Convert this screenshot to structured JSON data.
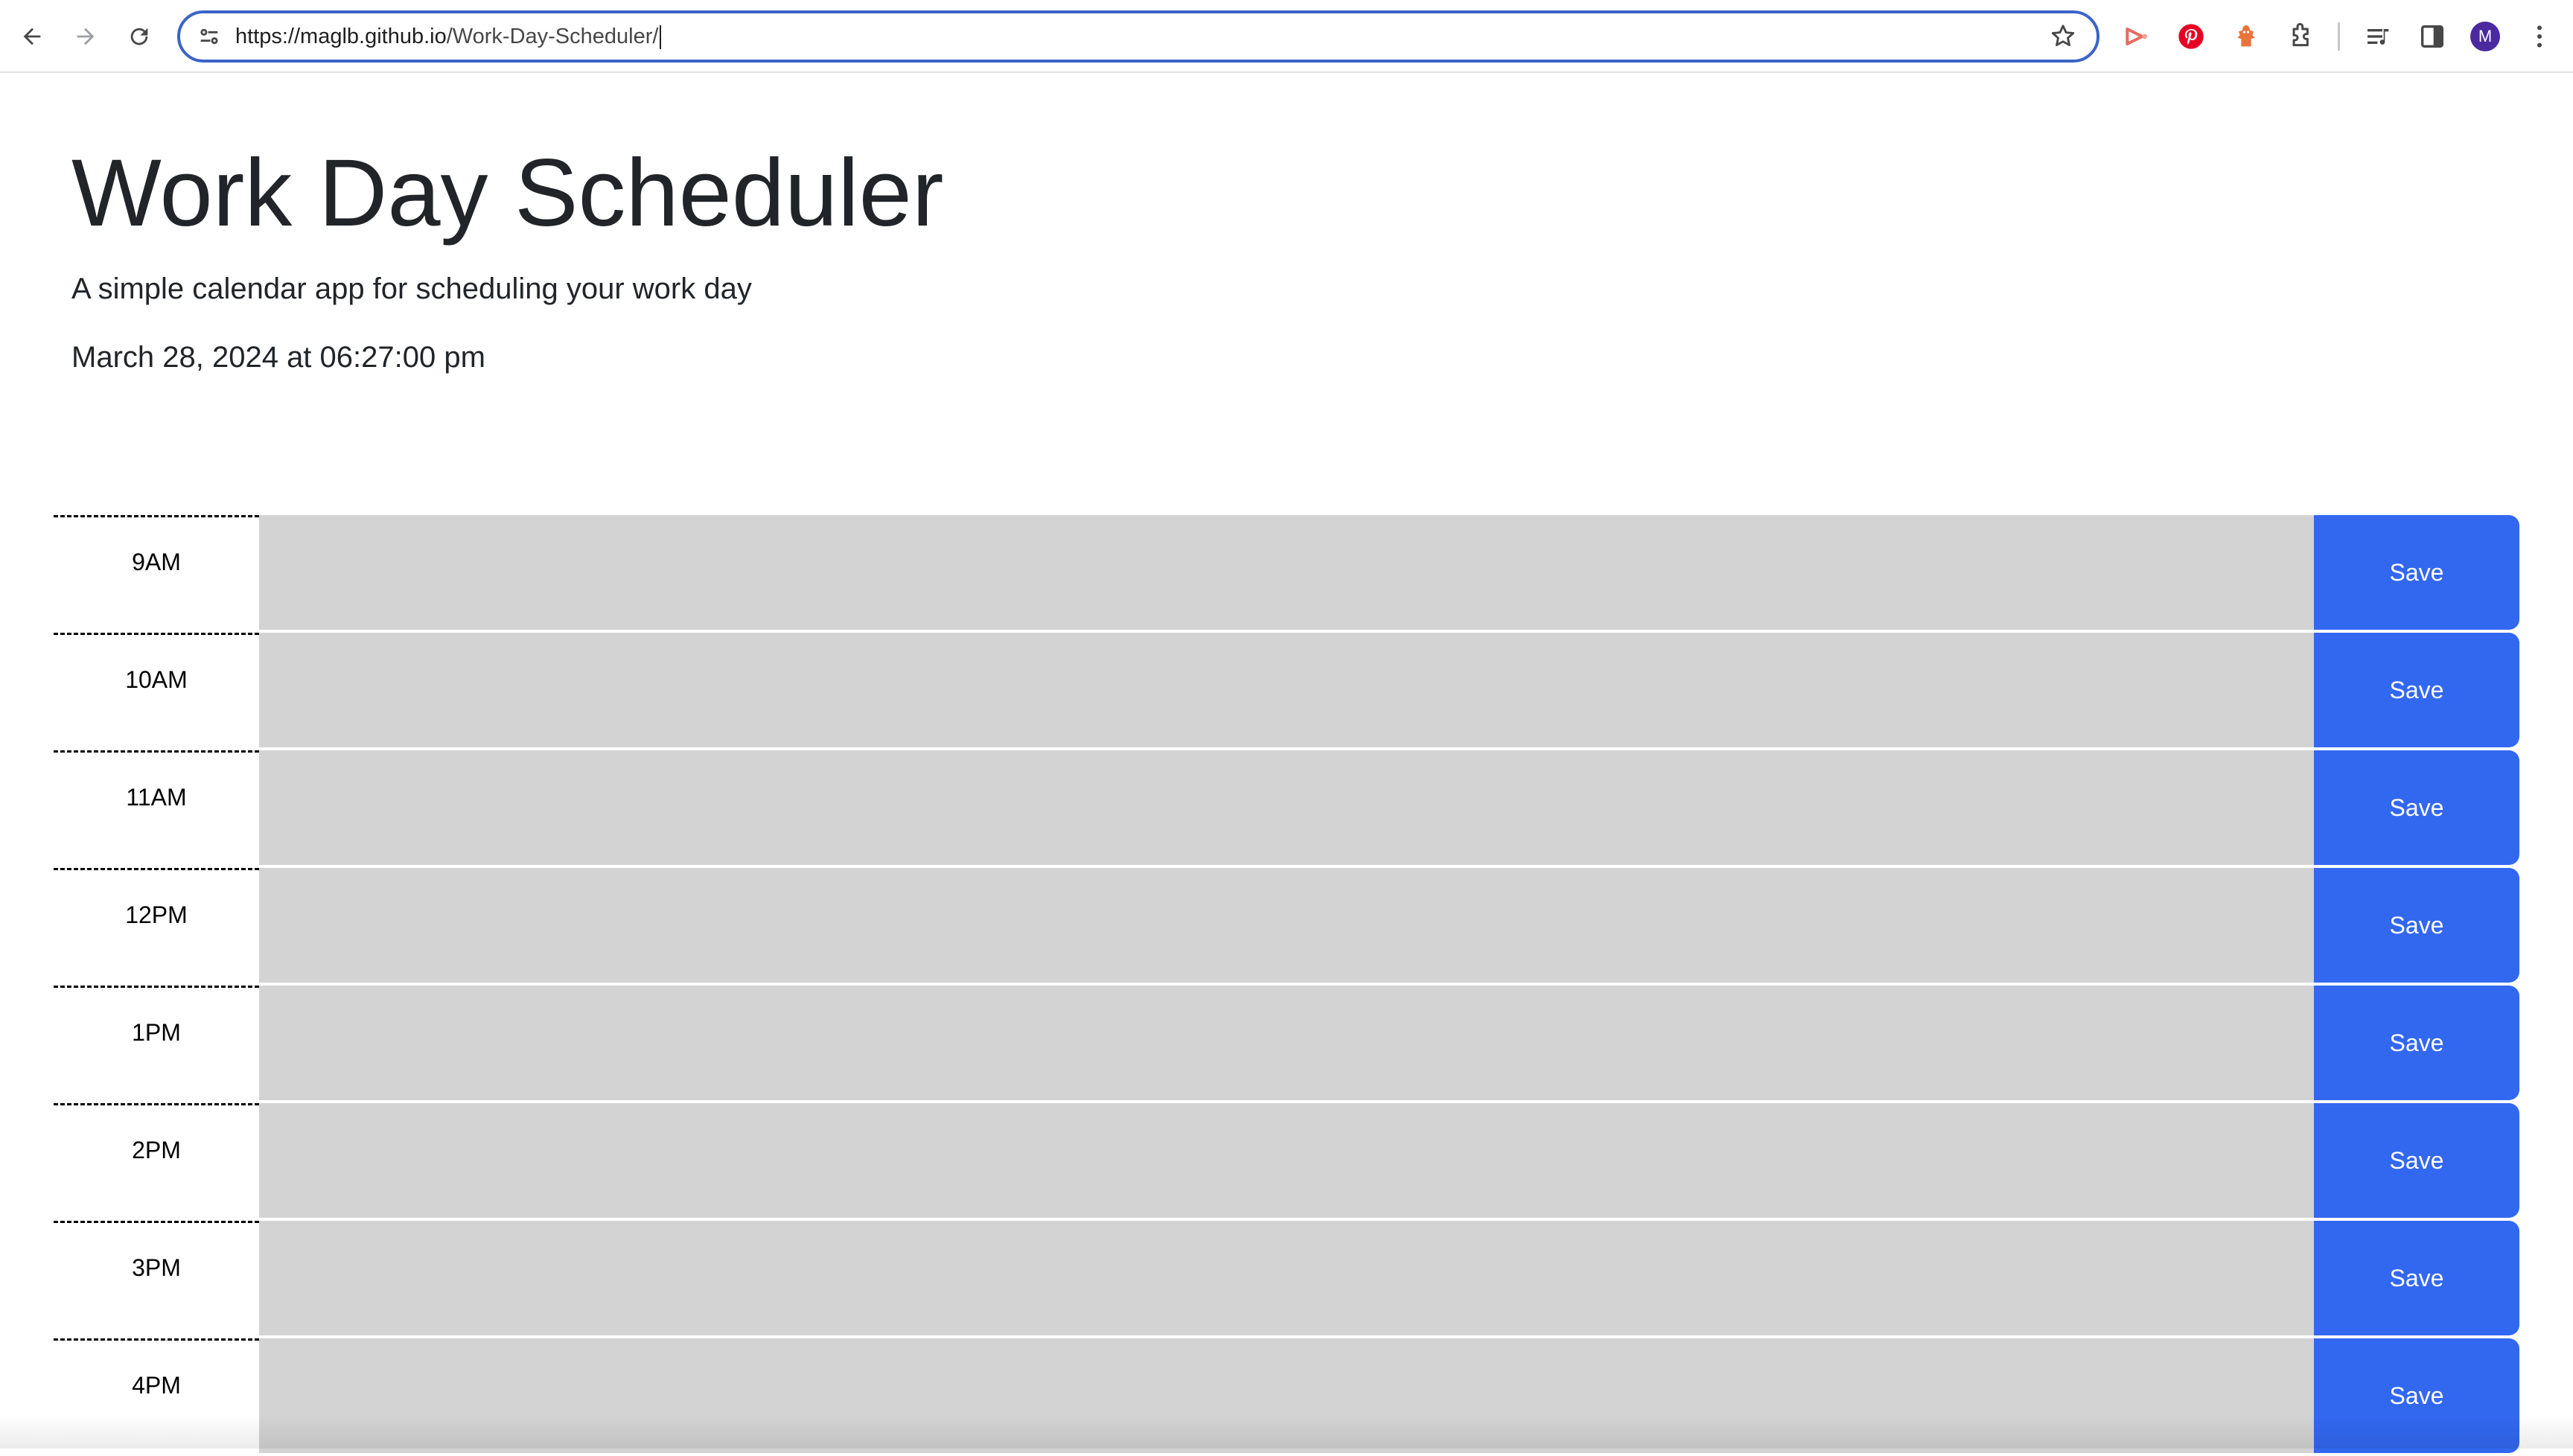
{
  "browser": {
    "url_host": "https://maglb.github.io",
    "url_path": "/Work-Day-Scheduler/",
    "profile_initial": "M",
    "extensions": [
      "video-extension-icon",
      "pinterest-icon",
      "fox-extension-icon",
      "puzzle-extensions-icon"
    ],
    "colors": {
      "omnibox_border": "#3c64c8",
      "avatar": "#4a2a9e"
    }
  },
  "header": {
    "title": "Work Day Scheduler",
    "lead": "A simple calendar app for scheduling your work day",
    "current_day": "March 28, 2024 at 06:27:00 pm"
  },
  "schedule": {
    "blocks": [
      {
        "hour": "9AM",
        "description": "",
        "save_label": "Save"
      },
      {
        "hour": "10AM",
        "description": "",
        "save_label": "Save"
      },
      {
        "hour": "11AM",
        "description": "",
        "save_label": "Save"
      },
      {
        "hour": "12PM",
        "description": "",
        "save_label": "Save"
      },
      {
        "hour": "1PM",
        "description": "",
        "save_label": "Save"
      },
      {
        "hour": "2PM",
        "description": "",
        "save_label": "Save"
      },
      {
        "hour": "3PM",
        "description": "",
        "save_label": "Save"
      },
      {
        "hour": "4PM",
        "description": "",
        "save_label": "Save"
      }
    ],
    "colors": {
      "past_block": "#d3d3d3",
      "save_button": "#3268f0"
    }
  }
}
